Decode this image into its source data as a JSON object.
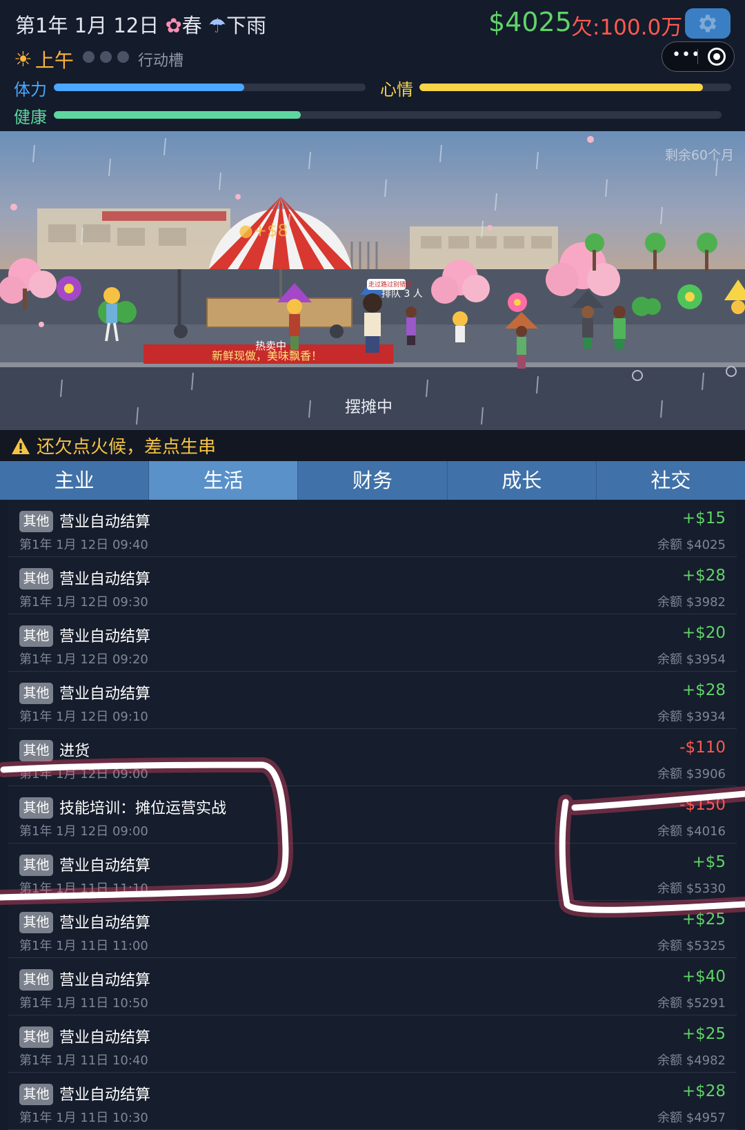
{
  "header": {
    "date": "第1年 1月 12日",
    "season": "春",
    "weather": "下雨",
    "money": "$4025",
    "debt": "欠:100.0万",
    "period": "上午",
    "action_slot_label": "行动槽"
  },
  "stats": {
    "stamina_label": "体力",
    "stamina_level": 0.61,
    "mood_label": "心情",
    "mood_level": 0.91,
    "health_label": "健康",
    "health_level": 0.37,
    "stamina_color": "#4aa8ff",
    "mood_color": "#f7d547",
    "health_color": "#5ed6a0"
  },
  "scene": {
    "remaining": "剩余60个月",
    "umbrella_income": "+$8",
    "banner": "新鲜现做，美味飘香！",
    "hot_sale": "热卖中",
    "queue": "排队 3 人",
    "speech": "走过路过别错过",
    "status": "摆摊中"
  },
  "warning": "还欠点火候，差点生串",
  "tabs": [
    {
      "label": "主业"
    },
    {
      "label": "生活"
    },
    {
      "label": "财务"
    },
    {
      "label": "成长"
    },
    {
      "label": "社交"
    }
  ],
  "transactions": [
    {
      "tag": "其他",
      "title": "营业自动结算",
      "time": "第1年 1月 12日 09:40",
      "amount": "+$15",
      "balance": "余额 $4025"
    },
    {
      "tag": "其他",
      "title": "营业自动结算",
      "time": "第1年 1月 12日 09:30",
      "amount": "+$28",
      "balance": "余额 $3982"
    },
    {
      "tag": "其他",
      "title": "营业自动结算",
      "time": "第1年 1月 12日 09:20",
      "amount": "+$20",
      "balance": "余额 $3954"
    },
    {
      "tag": "其他",
      "title": "营业自动结算",
      "time": "第1年 1月 12日 09:10",
      "amount": "+$28",
      "balance": "余额 $3934"
    },
    {
      "tag": "其他",
      "title": "进货",
      "time": "第1年 1月 12日 09:00",
      "amount": "-$110",
      "balance": "余额 $3906"
    },
    {
      "tag": "其他",
      "title": "技能培训：摊位运营实战",
      "time": "第1年 1月 12日 09:00",
      "amount": "-$150",
      "balance": "余额 $4016"
    },
    {
      "tag": "其他",
      "title": "营业自动结算",
      "time": "第1年 1月 11日 11:10",
      "amount": "+$5",
      "balance": "余额 $5330"
    },
    {
      "tag": "其他",
      "title": "营业自动结算",
      "time": "第1年 1月 11日 11:00",
      "amount": "+$25",
      "balance": "余额 $5325"
    },
    {
      "tag": "其他",
      "title": "营业自动结算",
      "time": "第1年 1月 11日 10:50",
      "amount": "+$40",
      "balance": "余额 $5291"
    },
    {
      "tag": "其他",
      "title": "营业自动结算",
      "time": "第1年 1月 11日 10:40",
      "amount": "+$25",
      "balance": "余额 $4982"
    },
    {
      "tag": "其他",
      "title": "营业自动结算",
      "time": "第1年 1月 11日 10:30",
      "amount": "+$28",
      "balance": "余额 $4957"
    }
  ]
}
